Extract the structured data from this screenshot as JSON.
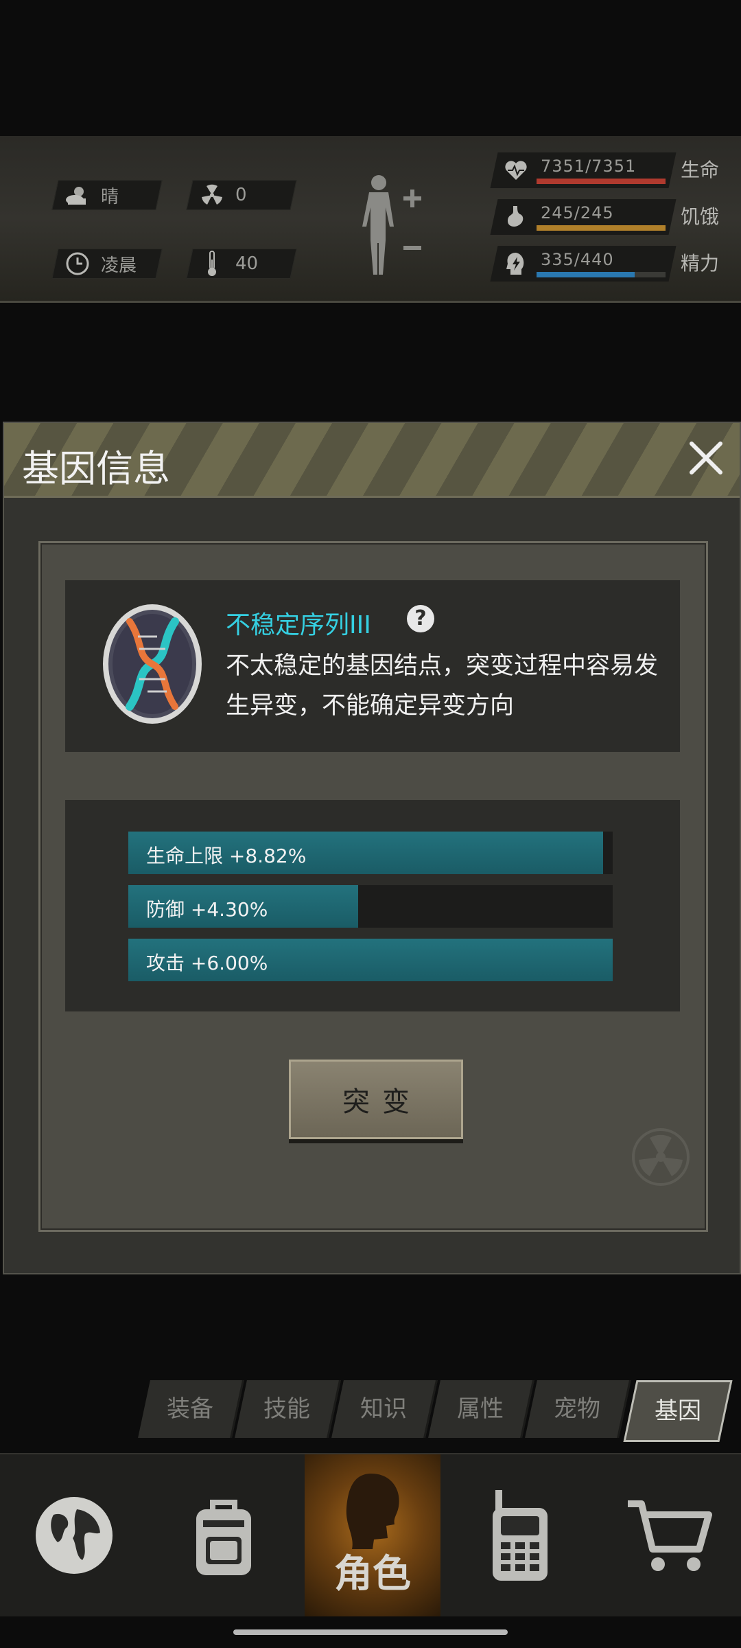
{
  "status": {
    "weather": {
      "label": "晴",
      "icon": "partly-cloudy-icon"
    },
    "radiation": {
      "value": "0",
      "icon": "radiation-icon"
    },
    "time_of_day": {
      "label": "凌晨",
      "icon": "clock-icon"
    },
    "temperature": {
      "value": "40",
      "icon": "thermometer-icon"
    },
    "body_icon": "body-modify-icon",
    "stats": [
      {
        "label": "生命",
        "value": "7351/7351",
        "fraction": 1.0,
        "color": "#b03a2e",
        "icon": "heart-icon"
      },
      {
        "label": "饥饿",
        "value": "245/245",
        "fraction": 1.0,
        "color": "#b0802a",
        "icon": "stomach-icon"
      },
      {
        "label": "精力",
        "value": "335/440",
        "fraction": 0.76,
        "color": "#2a78b0",
        "icon": "energy-icon"
      }
    ]
  },
  "modal": {
    "title": "基因信息",
    "gene": {
      "name": "不稳定序列III",
      "help": "?",
      "description": "不太稳定的基因结点，突变过程中容易发生异变，不能确定异变方向",
      "icon": "dna-icon"
    },
    "attributes": [
      {
        "label": "生命上限 +8.82%",
        "fraction": 0.98
      },
      {
        "label": "防御 +4.30%",
        "fraction": 0.475
      },
      {
        "label": "攻击 +6.00%",
        "fraction": 1.0
      }
    ],
    "mutate_button": "突变"
  },
  "sub_tabs": [
    {
      "label": "装备",
      "active": false
    },
    {
      "label": "技能",
      "active": false
    },
    {
      "label": "知识",
      "active": false
    },
    {
      "label": "属性",
      "active": false
    },
    {
      "label": "宠物",
      "active": false
    },
    {
      "label": "基因",
      "active": true
    }
  ],
  "bottom_nav": {
    "items": [
      {
        "icon": "globe-icon"
      },
      {
        "icon": "backpack-icon"
      },
      {
        "icon": "character-icon",
        "label": "角色",
        "active": true
      },
      {
        "icon": "radio-icon"
      },
      {
        "icon": "cart-icon"
      }
    ]
  },
  "colors": {
    "accent_cyan": "#35d0e2",
    "attr_fill": "#23727d",
    "header_stripe": "#6d6a4e"
  }
}
